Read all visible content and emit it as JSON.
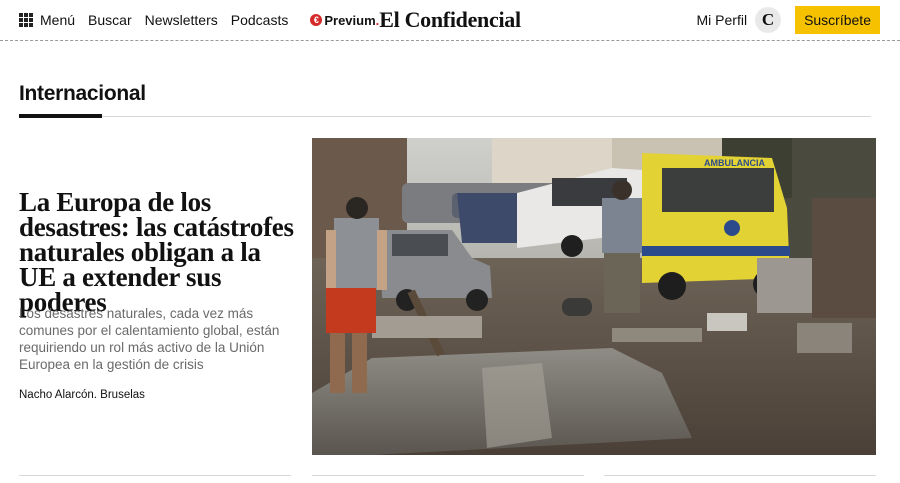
{
  "header": {
    "menu_label": "Menú",
    "search_label": "Buscar",
    "newsletters_label": "Newsletters",
    "podcasts_label": "Podcasts",
    "previum_label": "Previum",
    "previum_period": ".",
    "brand": "El Confidencial",
    "profile_label": "Mi Perfil",
    "avatar_letter": "C",
    "subscribe_label": "Suscríbete"
  },
  "section": {
    "title": "Internacional"
  },
  "article": {
    "headline": "La Europa de los desastres: las catástrofes naturales obligan a la UE a extender sus poderes",
    "summary": "Los desastres naturales, cada vez más comunes por el calentamiento global, están requiriendo un rol más activo de la Unión Europea en la gestión de crisis",
    "byline": "Nacho Alarcón. Bruselas",
    "image": {
      "ambulance_text": "AMBULANCIA"
    }
  },
  "colors": {
    "subscribe_bg": "#f6c200",
    "previum_red": "#d62b2b",
    "ambulance_yellow": "#e3d233"
  }
}
